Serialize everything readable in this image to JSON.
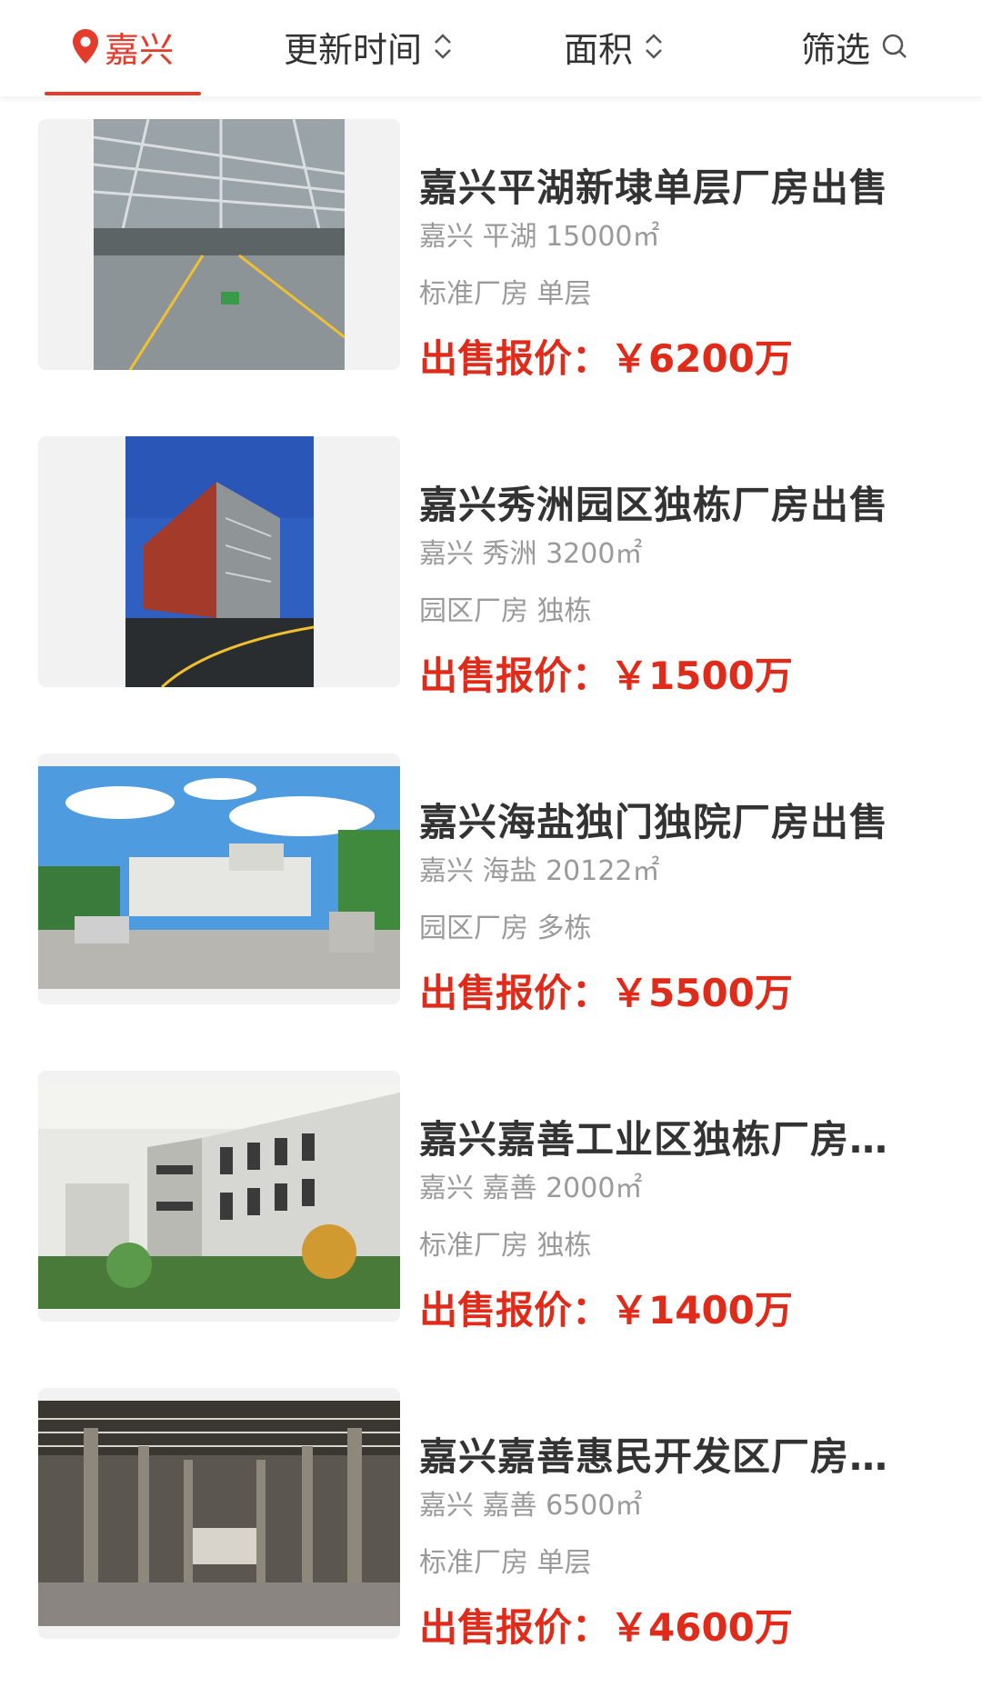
{
  "filters": {
    "city": "嘉兴",
    "update_time": "更新时间",
    "area": "面积",
    "screen": "筛选"
  },
  "colors": {
    "accent": "#e33b2c",
    "price": "#e02a1a",
    "title": "#333333",
    "meta": "#9a9a9a"
  },
  "listings": [
    {
      "title": "嘉兴平湖新埭单层厂房出售",
      "location": "嘉兴 平湖 15000㎡",
      "type": "标准厂房 单层",
      "price_label": "出售报价：",
      "price": "￥6200万",
      "image": "factory-interior"
    },
    {
      "title": "嘉兴秀洲园区独栋厂房出售",
      "location": "嘉兴 秀洲 3200㎡",
      "type": "园区厂房 独栋",
      "price_label": "出售报价：",
      "price": "￥1500万",
      "image": "building-exterior"
    },
    {
      "title": "嘉兴海盐独门独院厂房出售",
      "location": "嘉兴 海盐 20122㎡",
      "type": "园区厂房 多栋",
      "price_label": "出售报价：",
      "price": "￥5500万",
      "image": "park-gate"
    },
    {
      "title": "嘉兴嘉善工业区独栋厂房出售",
      "location": "嘉兴 嘉善 2000㎡",
      "type": "标准厂房 独栋",
      "price_label": "出售报价：",
      "price": "￥1400万",
      "image": "building-model"
    },
    {
      "title": "嘉兴嘉善惠民开发区厂房出售",
      "location": "嘉兴 嘉善 6500㎡",
      "type": "标准厂房 单层",
      "price_label": "出售报价：",
      "price": "￥4600万",
      "image": "warehouse-interior"
    }
  ]
}
